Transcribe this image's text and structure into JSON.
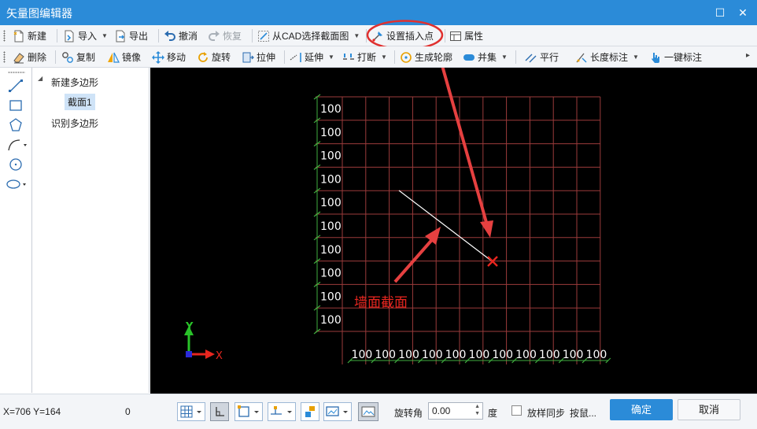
{
  "window": {
    "title": "矢量图编辑器",
    "maximize_glyph": "☐",
    "close_glyph": "✕"
  },
  "toolbar1": {
    "new": "新建",
    "import": "导入",
    "export": "导出",
    "undo": "撤消",
    "redo": "恢复",
    "from_cad": "从CAD选择截面图",
    "set_insert_point": "设置插入点",
    "properties": "属性"
  },
  "toolbar2": {
    "delete": "删除",
    "copy": "复制",
    "mirror": "镜像",
    "move": "移动",
    "rotate": "旋转",
    "stretch": "拉伸",
    "extend": "延伸",
    "break": "打断",
    "gen_contour": "生成轮廓",
    "union": "并集",
    "parallel": "平行",
    "length_dim": "长度标注",
    "one_click_dim": "一键标注"
  },
  "tree": {
    "root": "新建多边形",
    "child": "截面1",
    "other": "识别多边形",
    "expand_glyph": "◢"
  },
  "canvas": {
    "cell_label": "100",
    "annotation": "墙面截面",
    "axis_y": "Y",
    "axis_x": "X",
    "colors": {
      "grid": "#9b3b3b",
      "tick": "#3fae3f",
      "label": "#ffffff",
      "insert": "#e8261f",
      "annotation": "#e8261f",
      "arrow": "#e64040"
    }
  },
  "status": {
    "coords": "X=706 Y=164",
    "value": "0",
    "rotation_label": "旋转角",
    "rotation_value": "0.00",
    "degree": "度",
    "sync_label": "放样同步",
    "sync_extra": "按鼠...",
    "ok": "确定",
    "cancel": "取消"
  }
}
